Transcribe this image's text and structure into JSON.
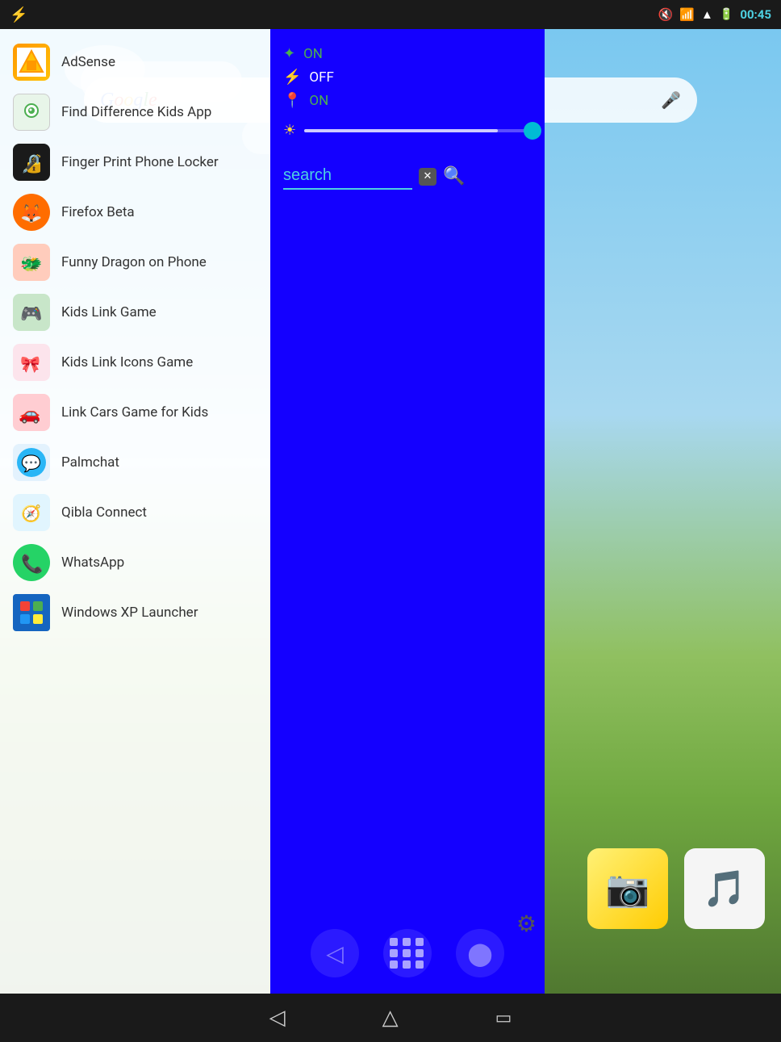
{
  "status_bar": {
    "time": "00:45",
    "usb_symbol": "⌁",
    "mute_icon": "🔇",
    "wifi_icon": "wifi",
    "signal_icon": "signal",
    "battery_icon": "battery"
  },
  "search_bar": {
    "google_text": "Google",
    "placeholder": ""
  },
  "app_list": [
    {
      "id": "adsense",
      "name": "AdSense",
      "icon_class": "icon-adsense",
      "icon_char": "A"
    },
    {
      "id": "find-diff",
      "name": "Find Difference Kids App",
      "icon_class": "icon-find-diff",
      "icon_char": "👁"
    },
    {
      "id": "fingerprint",
      "name": "Finger Print Phone Locker",
      "icon_class": "icon-fingerprint",
      "icon_char": "🔒"
    },
    {
      "id": "firefox",
      "name": "Firefox Beta",
      "icon_class": "icon-firefox",
      "icon_char": "🦊"
    },
    {
      "id": "dragon",
      "name": "Funny Dragon on Phone",
      "icon_class": "icon-dragon",
      "icon_char": "🐉"
    },
    {
      "id": "kids-link",
      "name": "Kids Link Game",
      "icon_class": "icon-kids-link",
      "icon_char": "🎮"
    },
    {
      "id": "kids-link-icons",
      "name": "Kids Link Icons Game",
      "icon_class": "icon-kids-link-icons",
      "icon_char": "🎀"
    },
    {
      "id": "link-cars",
      "name": "Link Cars Game for Kids",
      "icon_class": "icon-link-cars",
      "icon_char": "🚗"
    },
    {
      "id": "palmchat",
      "name": "Palmchat",
      "icon_class": "icon-palmchat",
      "icon_char": "💬"
    },
    {
      "id": "qibla",
      "name": "Qibla Connect",
      "icon_class": "icon-qibla",
      "icon_char": "🧭"
    },
    {
      "id": "whatsapp",
      "name": "WhatsApp",
      "icon_class": "icon-whatsapp",
      "icon_char": "📱"
    },
    {
      "id": "winxp",
      "name": "Windows XP Launcher",
      "icon_class": "icon-winxp",
      "icon_char": "🪟"
    }
  ],
  "blue_panel": {
    "wifi_label": "ON",
    "bluetooth_label": "OFF",
    "location_label": "ON",
    "search_placeholder": "search",
    "brightness_percent": 85
  },
  "navigation": {
    "back_label": "◁",
    "home_label": "△",
    "recents_label": "▭"
  }
}
